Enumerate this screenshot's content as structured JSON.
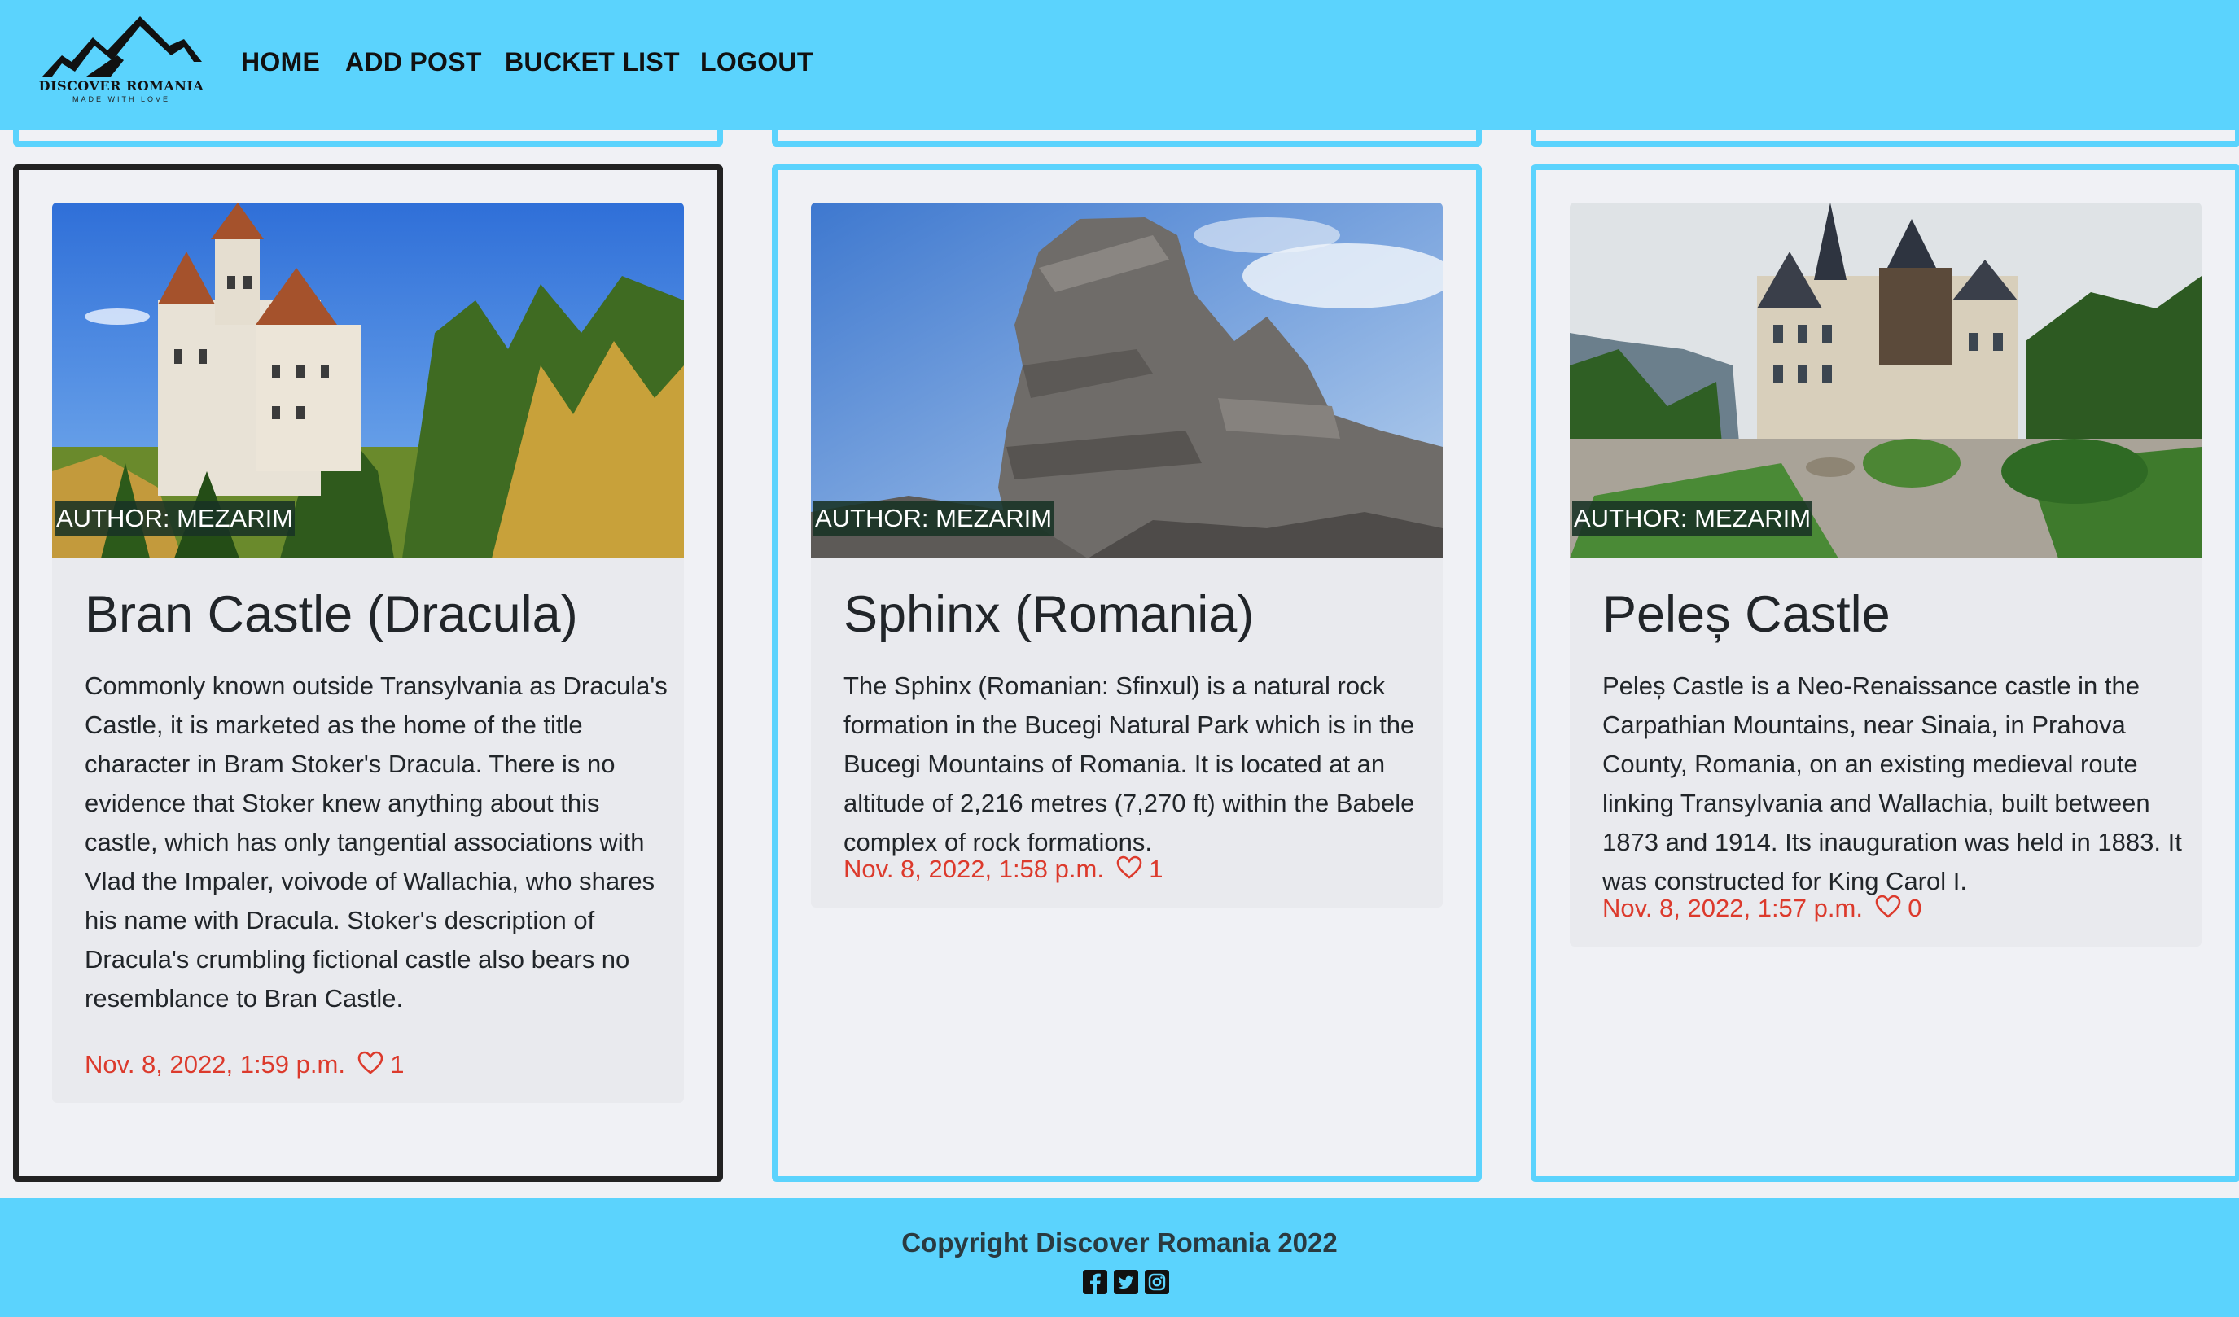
{
  "brand": {
    "title": "DISCOVER ROMANIA",
    "tagline": "MADE WITH LOVE"
  },
  "nav": {
    "home": "HOME",
    "add_post": "ADD POST",
    "bucket_list": "BUCKET LIST",
    "logout": "LOGOUT"
  },
  "posts": [
    {
      "author": "AUTHOR: MEZARIM",
      "title": "Bran Castle (Dracula)",
      "text": "Commonly known outside Transylvania as Dracula's Castle, it is marketed as the home of the title character in Bram Stoker's Dracula. There is no evidence that Stoker knew anything about this castle, which has only tangential associations with Vlad the Impaler, voivode of Wallachia, who shares his name with Dracula. Stoker's description of Dracula's crumbling fictional castle also bears no resemblance to Bran Castle.",
      "date": "Nov. 8, 2022, 1:59 p.m.",
      "likes": "1"
    },
    {
      "author": "AUTHOR: MEZARIM",
      "title": "Sphinx (Romania)",
      "text": "The Sphinx (Romanian: Sfinxul) is a natural rock formation in the Bucegi Natural Park which is in the Bucegi Mountains of Romania. It is located at an altitude of 2,216 metres (7,270 ft) within the Babele complex of rock formations.",
      "date": "Nov. 8, 2022, 1:58 p.m.",
      "likes": "1"
    },
    {
      "author": "AUTHOR: MEZARIM",
      "title": "Peleș Castle",
      "text": "Peleș Castle is a Neo-Renaissance castle in the Carpathian Mountains, near Sinaia, in Prahova County, Romania, on an existing medieval route linking Transylvania and Wallachia, built between 1873 and 1914. Its inauguration was held in 1883. It was constructed for King Carol I.",
      "date": "Nov. 8, 2022, 1:57 p.m.",
      "likes": "0"
    }
  ],
  "footer": {
    "copyright": "Copyright Discover Romania 2022",
    "socials": [
      "facebook-icon",
      "twitter-icon",
      "instagram-icon"
    ]
  },
  "colors": {
    "accent": "#5bd3fd",
    "meta": "#dc3a2c",
    "selected_border": "#222222",
    "page_bg": "#f0f1f5",
    "card_bg": "#e9eaee"
  }
}
